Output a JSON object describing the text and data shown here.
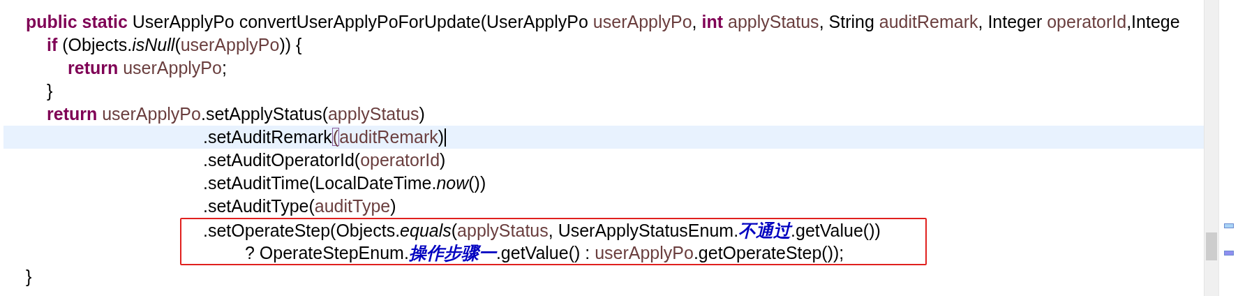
{
  "editor": {
    "lines": [
      {
        "kind": "statement",
        "tokens": [
          {
            "kind": "keyword",
            "text": "public static "
          },
          {
            "kind": "plain",
            "text": "UserApplyPo convertUserApplyPoForUpdate(UserApplyPo "
          },
          {
            "kind": "variable",
            "text": "userApplyPo"
          },
          {
            "kind": "plain",
            "text": ", "
          },
          {
            "kind": "keyword",
            "text": "int "
          },
          {
            "kind": "variable",
            "text": "applyStatus"
          },
          {
            "kind": "plain",
            "text": ", String "
          },
          {
            "kind": "variable",
            "text": "auditRemark"
          },
          {
            "kind": "plain",
            "text": ", Integer "
          },
          {
            "kind": "variable",
            "text": "operatorId"
          },
          {
            "kind": "plain",
            "text": ",Intege"
          }
        ],
        "children": [
          {
            "kind": "statement",
            "tokens": [
              {
                "kind": "keyword",
                "text": "if "
              },
              {
                "kind": "plain",
                "text": "(Objects."
              },
              {
                "kind": "static",
                "text": "isNull"
              },
              {
                "kind": "plain",
                "text": "("
              },
              {
                "kind": "variable",
                "text": "userApplyPo"
              },
              {
                "kind": "plain",
                "text": ")) {"
              }
            ],
            "children": [
              {
                "kind": "statement",
                "tokens": [
                  {
                    "kind": "keyword",
                    "text": "return "
                  },
                  {
                    "kind": "variable",
                    "text": "userApplyPo"
                  },
                  {
                    "kind": "plain",
                    "text": ";"
                  }
                ]
              }
            ]
          },
          {
            "kind": "statement",
            "tokens": [
              {
                "kind": "plain",
                "text": "}"
              }
            ]
          },
          {
            "kind": "statement",
            "tokens": [
              {
                "kind": "keyword",
                "text": "return "
              },
              {
                "kind": "variable",
                "text": "userApplyPo"
              },
              {
                "kind": "plain",
                "text": ".setApplyStatus("
              },
              {
                "kind": "variable",
                "text": "applyStatus"
              },
              {
                "kind": "plain",
                "text": ")"
              }
            ],
            "children": [
              {
                "kind": "continuation",
                "current": true,
                "cursor": true,
                "tokens": [
                  {
                    "kind": "plain",
                    "text": ".setAuditRemark"
                  },
                  {
                    "kind": "matched-bracket",
                    "text": "("
                  },
                  {
                    "kind": "variable",
                    "text": "auditRemark"
                  },
                  {
                    "kind": "plain",
                    "text": ")"
                  }
                ]
              },
              {
                "kind": "continuation",
                "tokens": [
                  {
                    "kind": "plain",
                    "text": ".setAuditOperatorId("
                  },
                  {
                    "kind": "variable",
                    "text": "operatorId"
                  },
                  {
                    "kind": "plain",
                    "text": ")"
                  }
                ]
              },
              {
                "kind": "continuation",
                "tokens": [
                  {
                    "kind": "plain",
                    "text": ".setAuditTime(LocalDateTime."
                  },
                  {
                    "kind": "static",
                    "text": "now"
                  },
                  {
                    "kind": "plain",
                    "text": "())"
                  }
                ]
              },
              {
                "kind": "continuation",
                "tokens": [
                  {
                    "kind": "plain",
                    "text": ".setAuditType("
                  },
                  {
                    "kind": "variable",
                    "text": "auditType"
                  },
                  {
                    "kind": "plain",
                    "text": ")"
                  }
                ]
              },
              {
                "kind": "continuation",
                "boxed": true,
                "tokens": [
                  {
                    "kind": "plain",
                    "text": ".setOperateStep(Objects."
                  },
                  {
                    "kind": "static",
                    "text": "equals"
                  },
                  {
                    "kind": "plain",
                    "text": "("
                  },
                  {
                    "kind": "variable",
                    "text": "applyStatus"
                  },
                  {
                    "kind": "plain",
                    "text": ", UserApplyStatusEnum."
                  },
                  {
                    "kind": "enum",
                    "text": "不通过"
                  },
                  {
                    "kind": "plain",
                    "text": ".getValue())"
                  }
                ],
                "children": [
                  {
                    "kind": "ternary",
                    "tokens": [
                      {
                        "kind": "plain",
                        "text": "? OperateStepEnum."
                      },
                      {
                        "kind": "enum",
                        "text": "操作步骤一"
                      },
                      {
                        "kind": "plain",
                        "text": ".getValue() : "
                      },
                      {
                        "kind": "variable",
                        "text": "userApplyPo"
                      },
                      {
                        "kind": "plain",
                        "text": ".getOperateStep());"
                      }
                    ]
                  }
                ]
              }
            ]
          }
        ]
      },
      {
        "kind": "statement",
        "tokens": [
          {
            "kind": "plain",
            "text": "}"
          }
        ]
      }
    ]
  },
  "overview_ruler": {
    "marks": [
      {
        "color": "#a9d3f5"
      },
      {
        "color": "#8f8fef"
      }
    ]
  }
}
